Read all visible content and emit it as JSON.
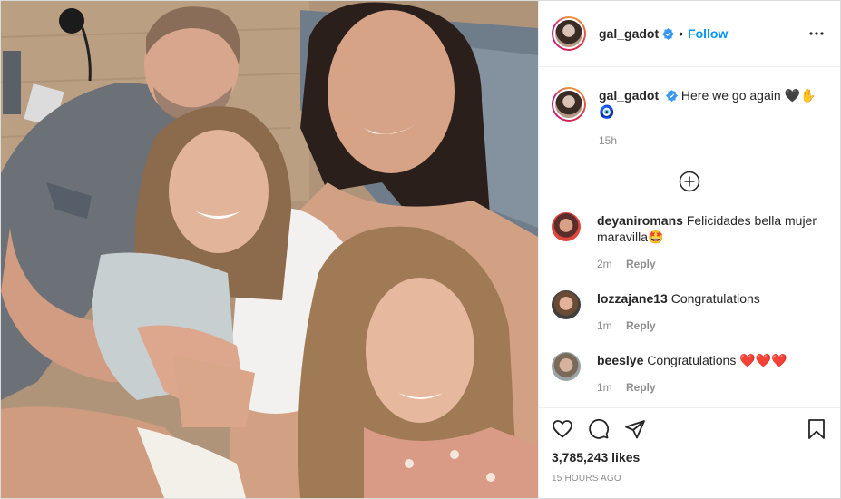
{
  "post": {
    "username": "gal_gadot",
    "follow_label": "Follow",
    "separator": "•",
    "caption_text": "Here we go again 🖤✋",
    "caption_extra": "🧿",
    "caption_time": "15h",
    "likes": "3,785,243 likes",
    "timestamp": "15 HOURS AGO"
  },
  "comments": [
    {
      "username": "deyaniromans",
      "text": "Felicidades bella mujer maravilla🤩",
      "time": "2m",
      "reply": "Reply"
    },
    {
      "username": "lozzajane13",
      "text": "Congratulations",
      "time": "1m",
      "reply": "Reply"
    },
    {
      "username": "beeslye",
      "text": "Congratulations",
      "hearts": "❤️❤️❤️",
      "time": "1m",
      "reply": "Reply"
    }
  ],
  "icons": {
    "verified": "verified-badge-icon",
    "more": "more-options-icon",
    "load_more": "plus-circle-icon",
    "like": "heart-icon",
    "comment": "comment-icon",
    "share": "share-icon",
    "save": "bookmark-icon"
  },
  "colors": {
    "accent": "#0095f6",
    "verified": "#3897f0",
    "muted": "#8e8e8e",
    "text": "#262626"
  }
}
